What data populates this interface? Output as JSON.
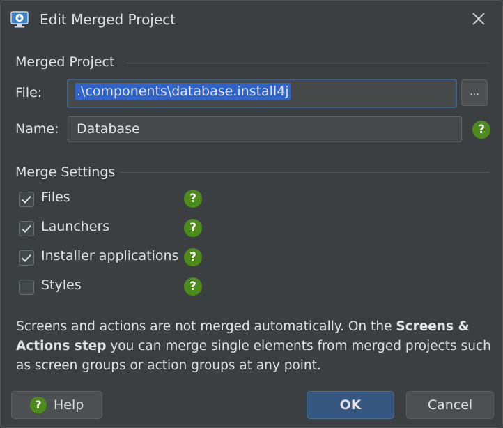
{
  "window": {
    "title": "Edit Merged Project",
    "app_icon": "install4j-icon",
    "close_icon": "close-icon"
  },
  "merged_project": {
    "section_title": "Merged Project",
    "file_label": "File:",
    "file_value": ".\\components\\database.install4j",
    "browse_label": "...",
    "name_label": "Name:",
    "name_value": "Database"
  },
  "merge_settings": {
    "section_title": "Merge Settings",
    "items": [
      {
        "label": "Files",
        "checked": true
      },
      {
        "label": "Launchers",
        "checked": true
      },
      {
        "label": "Installer applications",
        "checked": true
      },
      {
        "label": "Styles",
        "checked": false
      }
    ]
  },
  "note": {
    "part1": "Screens and actions are not merged automatically. On the ",
    "bold": "Screens & Actions step",
    "part2": " you can merge single elements from merged projects such as screen groups or action groups at any point."
  },
  "buttons": {
    "help_icon": "?",
    "help_label": "Help",
    "ok_label": "OK",
    "cancel_label": "Cancel"
  },
  "help_glyph": "?",
  "colors": {
    "background": "#3c3f41",
    "help_green": "#4d8b1d",
    "primary_button": "#365880",
    "selection": "#2f65ca",
    "focus_border": "#3d6185"
  }
}
